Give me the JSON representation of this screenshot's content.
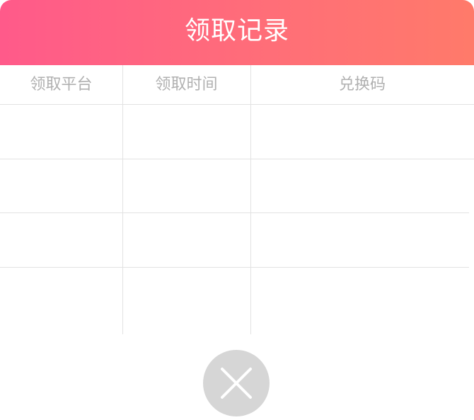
{
  "dialog": {
    "title": "领取记录",
    "table": {
      "headers": [
        "领取平台",
        "领取时间",
        "兑换码"
      ],
      "rows": [
        [
          "",
          "",
          ""
        ],
        [
          "",
          "",
          ""
        ],
        [
          "",
          "",
          ""
        ],
        [
          "",
          "",
          ""
        ]
      ]
    },
    "close": {
      "icon": "close-icon"
    }
  }
}
